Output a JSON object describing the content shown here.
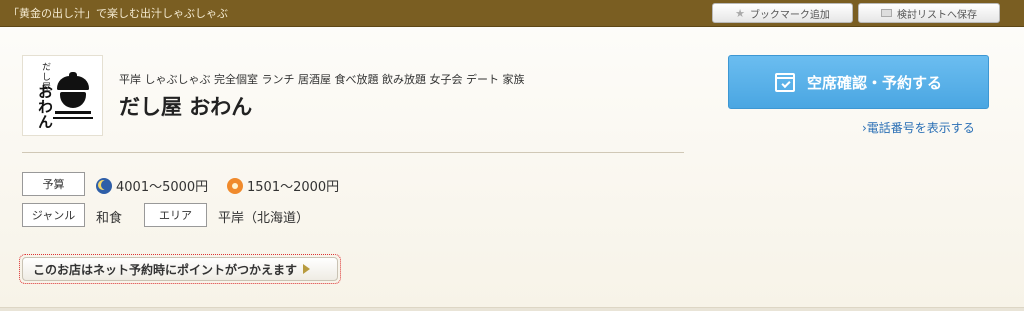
{
  "header": {
    "tagline": "「黄金の出し汁」で楽しむ出汁しゃぶしゃぶ",
    "bookmark_label": "ブックマーク追加",
    "save_list_label": "検討リストへ保存"
  },
  "shop": {
    "genres": "平岸 しゃぶしゃぶ 完全個室 ランチ 居酒屋 食べ放題 飲み放題 女子会 デート 家族",
    "name": "だし屋 おわん",
    "logo_small": "だし屋",
    "logo_big": "おわん"
  },
  "details": {
    "budget_label": "予算",
    "budget_dinner": "4001〜5000円",
    "budget_lunch": "1501〜2000円",
    "genre_label": "ジャンル",
    "genre_value": "和食",
    "area_label": "エリア",
    "area_value": "平岸（北海道）"
  },
  "point_banner": "このお店はネット予約時にポイントがつかえます",
  "actions": {
    "reserve_label": "空席確認・予約する",
    "phone_link": "›電話番号を表示する"
  },
  "colors": {
    "header_bg": "#7a5e22",
    "reserve_blue": "#4aa6e2",
    "link_blue": "#2a6fb5",
    "banner_dotted_border": "#dd3333"
  }
}
